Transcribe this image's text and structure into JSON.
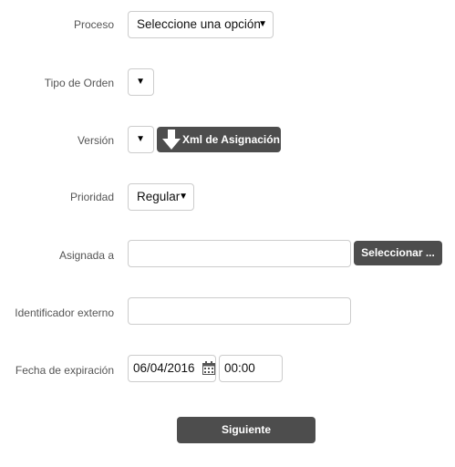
{
  "form": {
    "proceso": {
      "label": "Proceso",
      "value": "Seleccione una opción"
    },
    "tipo_orden": {
      "label": "Tipo de Orden",
      "value": ""
    },
    "version": {
      "label": "Versión",
      "value": "",
      "xml_button": "Xml de Asignación"
    },
    "prioridad": {
      "label": "Prioridad",
      "value": "Regular"
    },
    "asignada": {
      "label": "Asignada a",
      "value": "",
      "select_button": "Seleccionar ..."
    },
    "identificador": {
      "label": "Identificador externo",
      "value": ""
    },
    "fecha": {
      "label": "Fecha de expiración",
      "date": "06/04/2016",
      "time": "00:00"
    }
  },
  "actions": {
    "next": "Siguiente"
  },
  "icons": {
    "dropdown": "▼",
    "download": "download-arrow-icon",
    "calendar": "calendar-icon"
  }
}
